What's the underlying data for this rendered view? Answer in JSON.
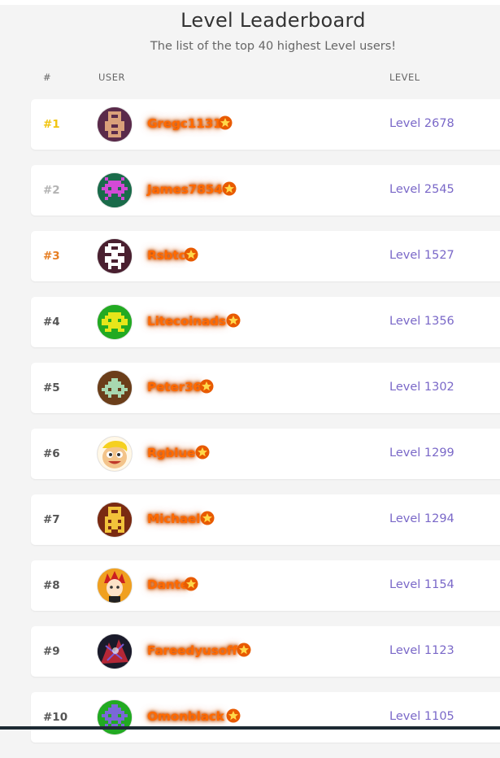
{
  "header": {
    "title": "Level Leaderboard",
    "subtitle": "The list of the top 40 highest Level users!"
  },
  "columns": {
    "rank": "#",
    "user": "USER",
    "level": "LEVEL"
  },
  "colors": {
    "gold": "#f1c40f",
    "silver": "#b3b3b3",
    "bronze": "#e67e22",
    "username": "#ff6a00",
    "level": "#7a68c8"
  },
  "leaderboard": [
    {
      "rank": "#1",
      "username": "Gregc1131",
      "level": "Level 2678",
      "avatar_icon": "pixel-avatar-icon",
      "star_icon": "star-icon",
      "rank_color": "#f1c40f",
      "avatar_bg": "#5a2a4a",
      "avatar_fg": "#d9a07a"
    },
    {
      "rank": "#2",
      "username": "James7854",
      "level": "Level 2545",
      "avatar_icon": "pixel-avatar-icon",
      "star_icon": "star-icon",
      "rank_color": "#b3b3b3",
      "avatar_bg": "#1a6b4a",
      "avatar_fg": "#d24ad6"
    },
    {
      "rank": "#3",
      "username": "Rsbtc",
      "level": "Level 1527",
      "avatar_icon": "pixel-avatar-icon",
      "star_icon": "star-icon",
      "rank_color": "#e67e22",
      "avatar_bg": "#4a2030",
      "avatar_fg": "#ffffff"
    },
    {
      "rank": "#4",
      "username": "Litecoinads",
      "level": "Level 1356",
      "avatar_icon": "pixel-avatar-icon",
      "star_icon": "star-icon",
      "rank_color": "#555555",
      "avatar_bg": "#22aa22",
      "avatar_fg": "#e6e61a"
    },
    {
      "rank": "#5",
      "username": "Peter36",
      "level": "Level 1302",
      "avatar_icon": "pixel-avatar-icon",
      "star_icon": "star-icon",
      "rank_color": "#555555",
      "avatar_bg": "#6b3e1a",
      "avatar_fg": "#a8d8b0"
    },
    {
      "rank": "#6",
      "username": "Rgblue",
      "level": "Level 1299",
      "avatar_icon": "cartoon-face-avatar-icon",
      "star_icon": "star-icon",
      "rank_color": "#555555",
      "avatar_bg": "#f3c48a",
      "avatar_fg": "#f5d020"
    },
    {
      "rank": "#7",
      "username": "Michael",
      "level": "Level 1294",
      "avatar_icon": "pixel-avatar-icon",
      "star_icon": "star-icon",
      "rank_color": "#555555",
      "avatar_bg": "#7a2a12",
      "avatar_fg": "#f2c23a"
    },
    {
      "rank": "#8",
      "username": "Dante",
      "level": "Level 1154",
      "avatar_icon": "anime-avatar-icon",
      "star_icon": "star-icon",
      "rank_color": "#555555",
      "avatar_bg": "#f0a020",
      "avatar_fg": "#cc2020"
    },
    {
      "rank": "#9",
      "username": "Fareedyusoff",
      "level": "Level 1123",
      "avatar_icon": "dark-art-avatar-icon",
      "star_icon": "star-icon",
      "rank_color": "#555555",
      "avatar_bg": "#1a1a2a",
      "avatar_fg": "#d02a3a"
    },
    {
      "rank": "#10",
      "username": "Omonblack",
      "level": "Level 1105",
      "avatar_icon": "pixel-avatar-icon",
      "star_icon": "star-icon",
      "rank_color": "#555555",
      "avatar_bg": "#22aa22",
      "avatar_fg": "#7a68d8"
    }
  ]
}
